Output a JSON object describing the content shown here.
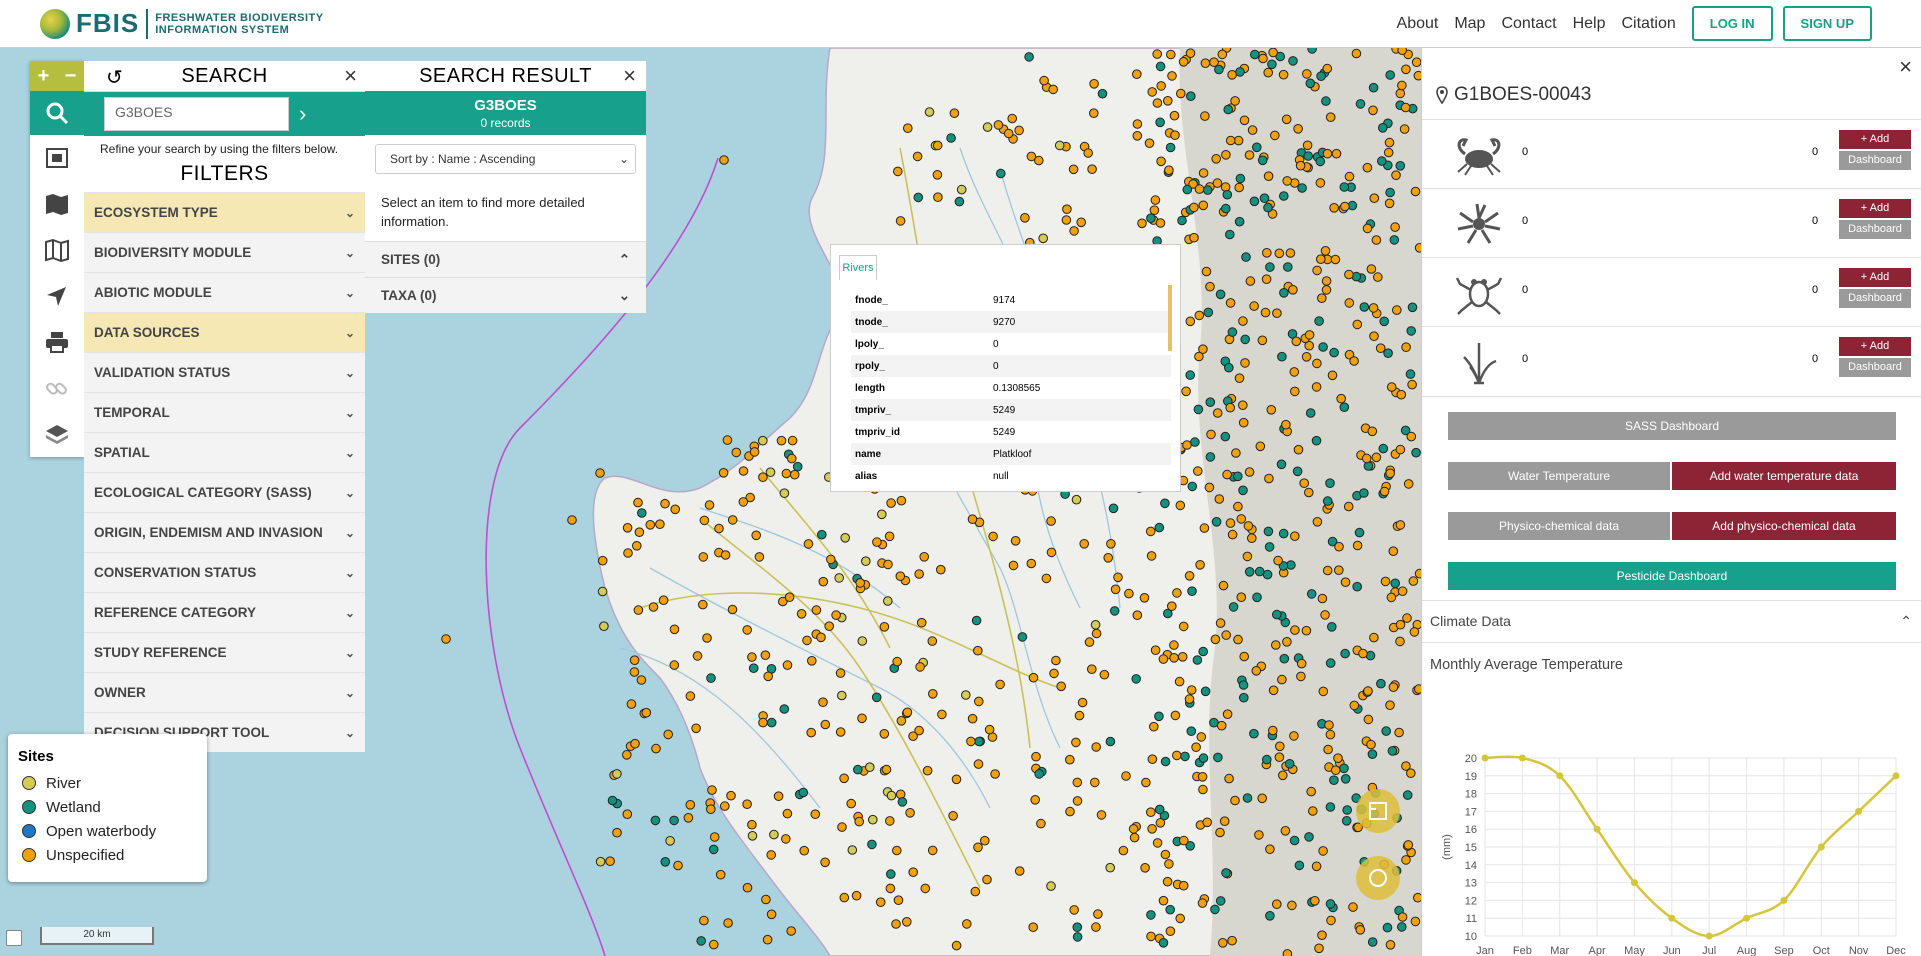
{
  "header": {
    "logo_text": "FBIS",
    "logo_full_line1": "FRESHWATER BIODIVERSITY",
    "logo_full_line2": "INFORMATION SYSTEM",
    "nav": [
      "About",
      "Map",
      "Contact",
      "Help",
      "Citation"
    ],
    "login_label": "LOG IN",
    "signup_label": "SIGN UP"
  },
  "toolbar": {
    "zoom_in": "+",
    "zoom_out": "−",
    "tools": [
      "search-icon",
      "polygon-select-icon",
      "map-icon",
      "book-map-icon",
      "locate-arrow-icon",
      "print-icon",
      "link-icon",
      "layers-icon"
    ]
  },
  "search": {
    "title": "SEARCH",
    "query": "G3BOES",
    "refine_text": "Refine your search by using the filters below.",
    "filters_title": "FILTERS",
    "filters": [
      {
        "label": "ECOSYSTEM TYPE",
        "highlight": true
      },
      {
        "label": "BIODIVERSITY MODULE",
        "highlight": false
      },
      {
        "label": "ABIOTIC MODULE",
        "highlight": false
      },
      {
        "label": "DATA SOURCES",
        "highlight": true
      },
      {
        "label": "VALIDATION STATUS",
        "highlight": false
      },
      {
        "label": "TEMPORAL",
        "highlight": false
      },
      {
        "label": "SPATIAL",
        "highlight": false
      },
      {
        "label": "ECOLOGICAL CATEGORY (SASS)",
        "highlight": false
      },
      {
        "label": "ORIGIN, ENDEMISM AND INVASION",
        "highlight": false
      },
      {
        "label": "CONSERVATION STATUS",
        "highlight": false
      },
      {
        "label": "REFERENCE CATEGORY",
        "highlight": false
      },
      {
        "label": "STUDY REFERENCE",
        "highlight": false
      },
      {
        "label": "OWNER",
        "highlight": false
      },
      {
        "label": "DECISION SUPPORT TOOL",
        "highlight": false
      }
    ]
  },
  "result": {
    "title": "SEARCH RESULT",
    "query": "G3BOES",
    "count": "0 records",
    "sort_label": "Sort by : Name : Ascending",
    "info": "Select an item to find more detailed information.",
    "sites_label": "SITES (0)",
    "taxa_label": "TAXA (0)"
  },
  "popup": {
    "tab": "Rivers",
    "rows": [
      {
        "k": "fnode_",
        "v": "9174"
      },
      {
        "k": "tnode_",
        "v": "9270"
      },
      {
        "k": "lpoly_",
        "v": "0"
      },
      {
        "k": "rpoly_",
        "v": "0"
      },
      {
        "k": "length",
        "v": "0.1308565"
      },
      {
        "k": "tmpriv_",
        "v": "5249"
      },
      {
        "k": "tmpriv_id",
        "v": "5249"
      },
      {
        "k": "name",
        "v": "Platkloof"
      },
      {
        "k": "alias",
        "v": "null"
      }
    ]
  },
  "legend": {
    "title": "Sites",
    "items": [
      {
        "label": "River",
        "color": "#d4cc55"
      },
      {
        "label": "Wetland",
        "color": "#14917f"
      },
      {
        "label": "Open waterbody",
        "color": "#1f78c4"
      },
      {
        "label": "Unspecified",
        "color": "#f2a10c"
      }
    ],
    "scale": "20 km"
  },
  "site": {
    "id": "G1BOES-00043",
    "taxa": [
      {
        "icon": "crab-icon",
        "count1": "0",
        "count2": "0"
      },
      {
        "icon": "insect-icon",
        "count1": "0",
        "count2": "0"
      },
      {
        "icon": "frog-icon",
        "count1": "0",
        "count2": "0"
      },
      {
        "icon": "plant-icon",
        "count1": "0",
        "count2": "0"
      }
    ],
    "add_label": "+ Add",
    "dashboard_label": "Dashboard",
    "sass_dashboard": "SASS Dashboard",
    "water_temp": "Water Temperature",
    "add_water_temp": "Add water temperature data",
    "physico": "Physico-chemical data",
    "add_physico": "Add physico-chemical data",
    "pesticide": "Pesticide Dashboard",
    "climate_label": "Climate Data",
    "chart_title": "Monthly Average Temperature"
  },
  "colors": {
    "teal": "#17a08b",
    "maroon": "#8d2436",
    "olive": "#b6be3f",
    "river": "#d4cc55",
    "wetland": "#14917f",
    "openwater": "#1f78c4",
    "unspecified": "#f2a10c"
  },
  "chart_data": {
    "type": "line",
    "title": "",
    "xlabel": "",
    "ylabel": "(mm)",
    "categories": [
      "Jan",
      "Feb",
      "Mar",
      "Apr",
      "May",
      "Jun",
      "Jul",
      "Aug",
      "Sep",
      "Oct",
      "Nov",
      "Dec"
    ],
    "values": [
      20,
      20,
      19,
      16,
      13,
      11,
      10,
      11,
      12,
      15,
      17,
      19
    ],
    "ylim": [
      10,
      20
    ],
    "yticks": [
      10,
      11,
      12,
      13,
      14,
      15,
      16,
      17,
      18,
      19,
      20
    ],
    "grid": true,
    "color": "#d4c53b"
  }
}
